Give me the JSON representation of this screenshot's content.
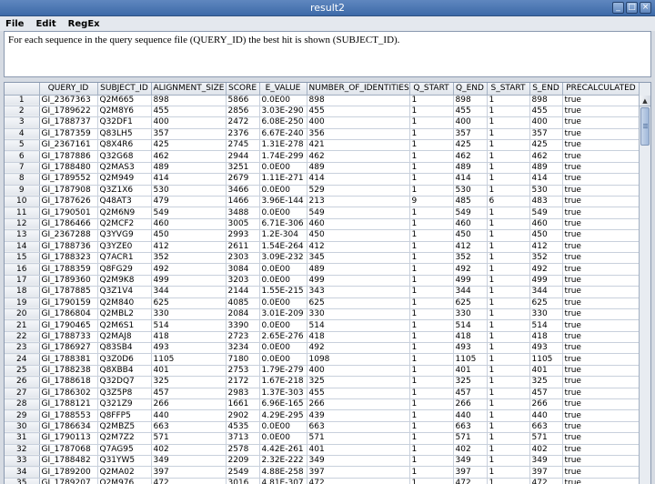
{
  "window": {
    "title": "result2"
  },
  "menu": [
    "File",
    "Edit",
    "RegEx"
  ],
  "description": "For each sequence in the query sequence file (QUERY_ID) the best hit is shown (SUBJECT_ID).",
  "table": {
    "columns": [
      "",
      "QUERY_ID",
      "SUBJECT_ID",
      "ALIGNMENT_SIZE",
      "SCORE",
      "E_VALUE",
      "NUMBER_OF_IDENTITIES",
      "Q_START",
      "Q_END",
      "S_START",
      "S_END",
      "PRECALCULATED"
    ],
    "rows": [
      [
        "1",
        "GI_2367363",
        "Q2M665",
        "898",
        "5866",
        "0.0E00",
        "898",
        "1",
        "898",
        "1",
        "898",
        "true"
      ],
      [
        "2",
        "GI_1789622",
        "Q2M8Y6",
        "455",
        "2856",
        "3.03E-290",
        "455",
        "1",
        "455",
        "1",
        "455",
        "true"
      ],
      [
        "3",
        "GI_1788737",
        "Q32DF1",
        "400",
        "2472",
        "6.08E-250",
        "400",
        "1",
        "400",
        "1",
        "400",
        "true"
      ],
      [
        "4",
        "GI_1787359",
        "Q83LH5",
        "357",
        "2376",
        "6.67E-240",
        "356",
        "1",
        "357",
        "1",
        "357",
        "true"
      ],
      [
        "5",
        "GI_2367161",
        "Q8X4R6",
        "425",
        "2745",
        "1.31E-278",
        "421",
        "1",
        "425",
        "1",
        "425",
        "true"
      ],
      [
        "6",
        "GI_1787886",
        "Q32G68",
        "462",
        "2944",
        "1.74E-299",
        "462",
        "1",
        "462",
        "1",
        "462",
        "true"
      ],
      [
        "7",
        "GI_1788480",
        "Q2MAS3",
        "489",
        "3251",
        "0.0E00",
        "489",
        "1",
        "489",
        "1",
        "489",
        "true"
      ],
      [
        "8",
        "GI_1789552",
        "Q2M949",
        "414",
        "2679",
        "1.11E-271",
        "414",
        "1",
        "414",
        "1",
        "414",
        "true"
      ],
      [
        "9",
        "GI_1787908",
        "Q3Z1X6",
        "530",
        "3466",
        "0.0E00",
        "529",
        "1",
        "530",
        "1",
        "530",
        "true"
      ],
      [
        "10",
        "GI_1787626",
        "Q48AT3",
        "479",
        "1466",
        "3.96E-144",
        "213",
        "9",
        "485",
        "6",
        "483",
        "true"
      ],
      [
        "11",
        "GI_1790501",
        "Q2M6N9",
        "549",
        "3488",
        "0.0E00",
        "549",
        "1",
        "549",
        "1",
        "549",
        "true"
      ],
      [
        "12",
        "GI_1786466",
        "Q2MCF2",
        "460",
        "3005",
        "6.71E-306",
        "460",
        "1",
        "460",
        "1",
        "460",
        "true"
      ],
      [
        "13",
        "GI_2367288",
        "Q3YVG9",
        "450",
        "2993",
        "1.2E-304",
        "450",
        "1",
        "450",
        "1",
        "450",
        "true"
      ],
      [
        "14",
        "GI_1788736",
        "Q3YZE0",
        "412",
        "2611",
        "1.54E-264",
        "412",
        "1",
        "412",
        "1",
        "412",
        "true"
      ],
      [
        "15",
        "GI_1788323",
        "Q7ACR1",
        "352",
        "2303",
        "3.09E-232",
        "345",
        "1",
        "352",
        "1",
        "352",
        "true"
      ],
      [
        "16",
        "GI_1788359",
        "Q8FG29",
        "492",
        "3084",
        "0.0E00",
        "489",
        "1",
        "492",
        "1",
        "492",
        "true"
      ],
      [
        "17",
        "GI_1789360",
        "Q2M9K8",
        "499",
        "3203",
        "0.0E00",
        "499",
        "1",
        "499",
        "1",
        "499",
        "true"
      ],
      [
        "18",
        "GI_1787885",
        "Q3Z1V4",
        "344",
        "2144",
        "1.55E-215",
        "343",
        "1",
        "344",
        "1",
        "344",
        "true"
      ],
      [
        "19",
        "GI_1790159",
        "Q2M840",
        "625",
        "4085",
        "0.0E00",
        "625",
        "1",
        "625",
        "1",
        "625",
        "true"
      ],
      [
        "20",
        "GI_1786804",
        "Q2MBL2",
        "330",
        "2084",
        "3.01E-209",
        "330",
        "1",
        "330",
        "1",
        "330",
        "true"
      ],
      [
        "21",
        "GI_1790465",
        "Q2M6S1",
        "514",
        "3390",
        "0.0E00",
        "514",
        "1",
        "514",
        "1",
        "514",
        "true"
      ],
      [
        "22",
        "GI_1788733",
        "Q2MAJ8",
        "418",
        "2723",
        "2.65E-276",
        "418",
        "1",
        "418",
        "1",
        "418",
        "true"
      ],
      [
        "23",
        "GI_1786927",
        "Q83SB4",
        "493",
        "3234",
        "0.0E00",
        "492",
        "1",
        "493",
        "1",
        "493",
        "true"
      ],
      [
        "24",
        "GI_1788381",
        "Q3Z0D6",
        "1105",
        "7180",
        "0.0E00",
        "1098",
        "1",
        "1105",
        "1",
        "1105",
        "true"
      ],
      [
        "25",
        "GI_1788238",
        "Q8XBB4",
        "401",
        "2753",
        "1.79E-279",
        "400",
        "1",
        "401",
        "1",
        "401",
        "true"
      ],
      [
        "26",
        "GI_1788618",
        "Q32DQ7",
        "325",
        "2172",
        "1.67E-218",
        "325",
        "1",
        "325",
        "1",
        "325",
        "true"
      ],
      [
        "27",
        "GI_1786302",
        "Q3Z5P8",
        "457",
        "2983",
        "1.37E-303",
        "455",
        "1",
        "457",
        "1",
        "457",
        "true"
      ],
      [
        "28",
        "GI_1788121",
        "Q321Z9",
        "266",
        "1661",
        "6.96E-165",
        "266",
        "1",
        "266",
        "1",
        "266",
        "true"
      ],
      [
        "29",
        "GI_1788553",
        "Q8FFP5",
        "440",
        "2902",
        "4.29E-295",
        "439",
        "1",
        "440",
        "1",
        "440",
        "true"
      ],
      [
        "30",
        "GI_1786634",
        "Q2MBZ5",
        "663",
        "4535",
        "0.0E00",
        "663",
        "1",
        "663",
        "1",
        "663",
        "true"
      ],
      [
        "31",
        "GI_1790113",
        "Q2M7Z2",
        "571",
        "3713",
        "0.0E00",
        "571",
        "1",
        "571",
        "1",
        "571",
        "true"
      ],
      [
        "32",
        "GI_1787068",
        "Q7AG95",
        "402",
        "2578",
        "4.42E-261",
        "401",
        "1",
        "402",
        "1",
        "402",
        "true"
      ],
      [
        "33",
        "GI_1788482",
        "Q31YW5",
        "349",
        "2209",
        "2.32E-222",
        "349",
        "1",
        "349",
        "1",
        "349",
        "true"
      ],
      [
        "34",
        "GI_1789200",
        "Q2MA02",
        "397",
        "2549",
        "4.88E-258",
        "397",
        "1",
        "397",
        "1",
        "397",
        "true"
      ],
      [
        "35",
        "GI_1789207",
        "Q2M976",
        "472",
        "3016",
        "4.81E-307",
        "472",
        "1",
        "472",
        "1",
        "472",
        "true"
      ]
    ]
  }
}
